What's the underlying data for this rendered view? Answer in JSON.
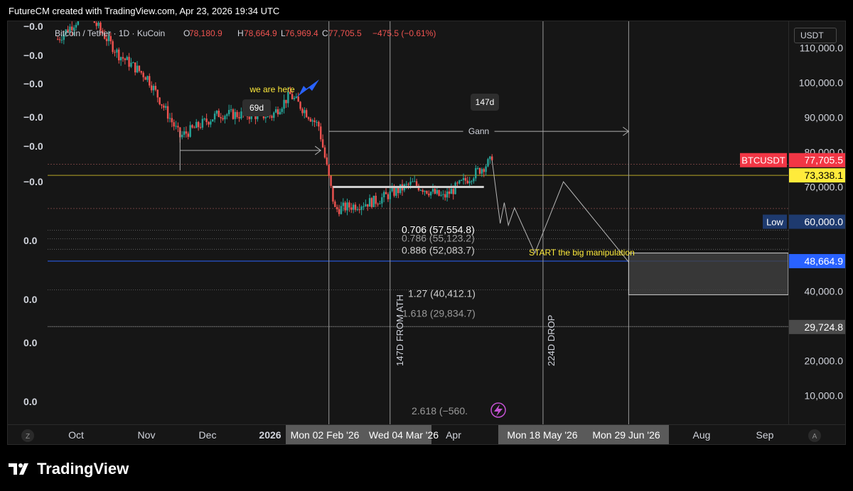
{
  "header": {
    "attribution": "FutureCM created with TradingView.com, Apr 23, 2026 19:34 UTC"
  },
  "colors": {
    "up": "#26a69a",
    "down": "#ef5350",
    "background": "#161616",
    "yellow": "#ffeb3b",
    "blue": "#2962ff",
    "arrow_blue": "#2962ff"
  },
  "symbol_line": {
    "title": "Bitcoin / Tether · 1D · KuCoin",
    "o_label": "O",
    "o": "78,180.9",
    "h_label": "H",
    "h": "78,664.9",
    "l_label": "L",
    "l": "76,969.4",
    "c_label": "C",
    "c": "77,705.5",
    "change": "−475.5 (−0.61%)"
  },
  "left_indicator_values": [
    "−0.0",
    "−0.0",
    "−0.0",
    "−0.0",
    "−0.0",
    "−0.0",
    "0.0",
    "0.0",
    "0.0",
    "0.0"
  ],
  "annotations": {
    "we_are_here": "we are here",
    "box_69d": "69d",
    "box_147d": "147d",
    "gann": "Gann",
    "start_manipulation": "START the big manipulation",
    "vertical_147d": "147D FROM ATH",
    "vertical_224d": "224D DROP",
    "low_label": "Low"
  },
  "fib_levels": [
    {
      "ratio": "0.706",
      "price": "57,554.8",
      "label": "0.706 (57,554.8)",
      "value": 57554.8
    },
    {
      "ratio": "0.786",
      "price": "55,123.2",
      "label": "0.786 (55,123.2)",
      "value": 55123.2
    },
    {
      "ratio": "0.886",
      "price": "52,083.7",
      "label": "0.886 (52,083.7)",
      "value": 52083.7
    },
    {
      "ratio": "1.27",
      "price": "40,412.1",
      "label": "1.27 (40,412.1)",
      "value": 40412.1
    },
    {
      "ratio": "1.618",
      "price": "29,834.7",
      "label": "1.618 (29,834.7)",
      "value": 29834.7
    },
    {
      "ratio": "2.618",
      "price": "−560.",
      "label": "2.618 (−560.",
      "value": -560
    }
  ],
  "price_axis": {
    "currency_button": "USDT",
    "ticks": [
      {
        "label": "110,000.0",
        "value": 110000
      },
      {
        "label": "100,000.0",
        "value": 100000
      },
      {
        "label": "90,000.0",
        "value": 90000
      },
      {
        "label": "80,000.0",
        "value": 80000
      },
      {
        "label": "70,000.0",
        "value": 70000
      },
      {
        "label": "40,000.0",
        "value": 40000
      },
      {
        "label": "30,000.0",
        "value": 30000
      },
      {
        "label": "20,000.0",
        "value": 20000
      },
      {
        "label": "10,000.0",
        "value": 10000
      }
    ],
    "badges": [
      {
        "name": "btcusdt",
        "tag": "BTCUSDT",
        "label": "77,705.5",
        "value": 77705.5,
        "bg": "#f23645",
        "fg": "#ffffff"
      },
      {
        "name": "yellow-level",
        "tag": "",
        "label": "73,338.1",
        "value": 73338.1,
        "bg": "#ffeb3b",
        "fg": "#000000"
      },
      {
        "name": "low",
        "tag": "Low",
        "label": "60,000.0",
        "value": 60000,
        "bg": "#1e3a6e",
        "fg": "#ffffff"
      },
      {
        "name": "blue-level",
        "tag": "",
        "label": "48,664.9",
        "value": 48664.9,
        "bg": "#2962ff",
        "fg": "#ffffff"
      },
      {
        "name": "bottom-level",
        "tag": "",
        "label": "29,724.8",
        "value": 29724.8,
        "bg": "#4a4a4a",
        "fg": "#ffffff"
      }
    ]
  },
  "time_axis": {
    "labels": [
      "Oct",
      "Nov",
      "Dec",
      "2026",
      "Apr",
      "Aug",
      "Sep"
    ],
    "highlights": [
      "Mon 02 Feb '26",
      "Wed 04 Mar '26",
      "Mon 18 May '26",
      "Mon 29 Jun '26"
    ]
  },
  "controls": {
    "zoom_left": "Z",
    "auto_right": "A"
  },
  "footer": {
    "brand": "TradingView",
    "logo_mark": "17"
  },
  "chart_data": {
    "type": "candlestick",
    "title": "Bitcoin / Tether · 1D · KuCoin",
    "ylim": [
      0,
      115000
    ],
    "xlim": [
      "2025-09-20",
      "2026-09-25"
    ],
    "segments": [
      {
        "from": "2025-09-22",
        "to": "2025-10-06",
        "start": 112500,
        "end": 120500
      },
      {
        "from": "2025-10-06",
        "to": "2025-10-22",
        "start": 120500,
        "end": 108000
      },
      {
        "from": "2025-10-22",
        "to": "2025-11-05",
        "start": 108000,
        "end": 101500
      },
      {
        "from": "2025-11-05",
        "to": "2025-11-21",
        "start": 101500,
        "end": 84500
      },
      {
        "from": "2025-11-21",
        "to": "2025-12-10",
        "start": 84500,
        "end": 91000
      },
      {
        "from": "2025-12-10",
        "to": "2026-01-05",
        "start": 91000,
        "end": 90500
      },
      {
        "from": "2026-01-05",
        "to": "2026-01-14",
        "start": 90500,
        "end": 96500
      },
      {
        "from": "2026-01-14",
        "to": "2026-01-28",
        "start": 96500,
        "end": 87500
      },
      {
        "from": "2026-01-28",
        "to": "2026-02-05",
        "start": 87500,
        "end": 63500
      },
      {
        "from": "2026-02-05",
        "to": "2026-02-25",
        "start": 63500,
        "end": 66000
      },
      {
        "from": "2026-02-25",
        "to": "2026-03-15",
        "start": 66000,
        "end": 71000
      },
      {
        "from": "2026-03-15",
        "to": "2026-03-30",
        "start": 71000,
        "end": 67000
      },
      {
        "from": "2026-03-30",
        "to": "2026-04-23",
        "start": 67000,
        "end": 77705.5
      }
    ],
    "projection": [
      {
        "date": "2026-04-23",
        "value": 77705.5
      },
      {
        "date": "2026-04-27",
        "value": 59500
      },
      {
        "date": "2026-04-29",
        "value": 65500
      },
      {
        "date": "2026-05-01",
        "value": 59000
      },
      {
        "date": "2026-05-04",
        "value": 64000
      },
      {
        "date": "2026-05-14",
        "value": 51000
      },
      {
        "date": "2026-05-28",
        "value": 71500
      },
      {
        "date": "2026-06-29",
        "value": 48400
      }
    ],
    "range_69d": {
      "from": "2025-11-21",
      "to": "2026-01-29",
      "value": 80500
    },
    "range_147d": {
      "from": "2026-02-02",
      "to": "2026-06-29",
      "value": 86000
    },
    "gray_range_line": {
      "from": "2026-02-04",
      "to": "2026-04-19",
      "value": 70000
    },
    "target_box": {
      "from": "2026-06-29",
      "to": "2026-09-25",
      "high": 51000,
      "low": 39000
    },
    "vlines": [
      "2026-02-02",
      "2026-03-04",
      "2026-05-18",
      "2026-06-29"
    ],
    "hlines": {
      "dotted_red": [
        76500,
        63800
      ],
      "yellow": 73338.1,
      "blue": 48664.9,
      "gray": [
        29834.7
      ]
    }
  }
}
